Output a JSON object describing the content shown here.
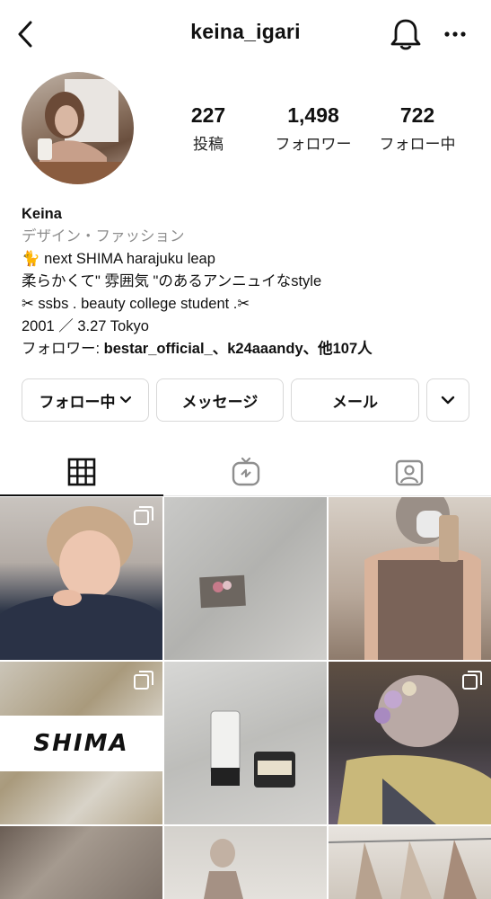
{
  "header": {
    "title": "keina_igari",
    "back_icon": "chevron-left-icon",
    "bell_icon": "bell-icon",
    "more_icon": "more-icon"
  },
  "stats": [
    {
      "value": "227",
      "label": "投稿"
    },
    {
      "value": "1,498",
      "label": "フォロワー"
    },
    {
      "value": "722",
      "label": "フォロー中"
    }
  ],
  "bio": {
    "name": "Keina",
    "category": "デザイン・ファッション",
    "line1": "🐈 next SHIMA harajuku leap",
    "line2": "柔らかくて\" 雰囲気 \"のあるアンニュイなstyle",
    "line3": "✂ ssbs . beauty college student .✂",
    "line4": "2001 ／ 3.27 Tokyo",
    "followers_prefix": "フォロワー: ",
    "followers_names": "bestar_official_、k24aaandy、他107人"
  },
  "buttons": {
    "following": "フォロー中",
    "message": "メッセージ",
    "mail": "メール"
  },
  "tabs": [
    "grid-icon",
    "igtv-icon",
    "tagged-icon"
  ],
  "grid": {
    "logo_text": "SHIMA"
  }
}
